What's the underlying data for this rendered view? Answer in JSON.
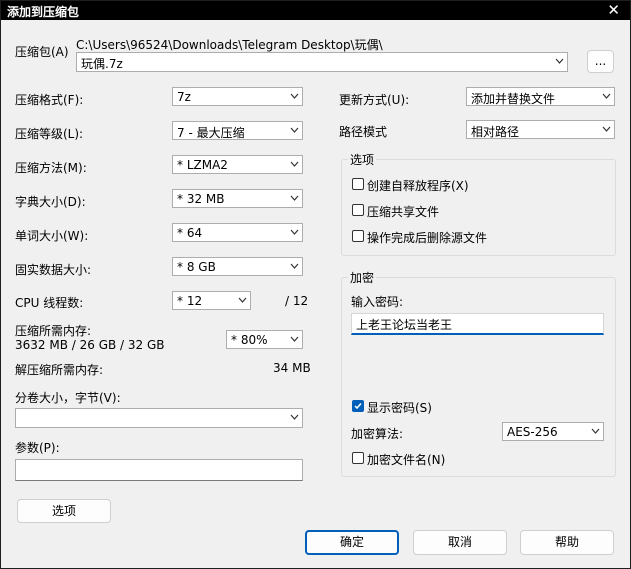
{
  "window": {
    "title": "添加到压缩包",
    "close_glyph": "✕"
  },
  "archive": {
    "label": "压缩包(A)",
    "path": "C:\\Users\\96524\\Downloads\\Telegram Desktop\\玩偶\\",
    "value": "玩偶.7z",
    "browse_label": "..."
  },
  "left": {
    "format": {
      "label": "压缩格式(F):",
      "value": "7z"
    },
    "level": {
      "label": "压缩等级(L):",
      "value": "7 - 最大压缩"
    },
    "method": {
      "label": "压缩方法(M):",
      "value": "* LZMA2"
    },
    "dict": {
      "label": "字典大小(D):",
      "value": "* 32 MB"
    },
    "word": {
      "label": "单词大小(W):",
      "value": "* 64"
    },
    "solid": {
      "label": "固实数据大小:",
      "value": "* 8 GB"
    },
    "threads": {
      "label": "CPU 线程数:",
      "value": "* 12",
      "max": "/ 12"
    },
    "mem": {
      "label": "压缩所需内存:",
      "detail": "3632 MB / 26 GB / 32 GB",
      "value": "* 80%"
    },
    "decomp": {
      "label": "解压缩所需内存:",
      "value": "34 MB"
    },
    "volume": {
      "label": "分卷大小，字节(V):",
      "value": ""
    },
    "params": {
      "label": "参数(P):",
      "value": ""
    },
    "options_button": "选项"
  },
  "right": {
    "update": {
      "label": "更新方式(U):",
      "value": "添加并替换文件"
    },
    "pathmode": {
      "label": "路径模式",
      "value": "相对路径"
    },
    "options_group": {
      "title": "选项",
      "items": [
        {
          "label": "创建自释放程序(X)",
          "checked": false
        },
        {
          "label": "压缩共享文件",
          "checked": false
        },
        {
          "label": "操作完成后删除源文件",
          "checked": false
        }
      ]
    },
    "encryption": {
      "title": "加密",
      "password_label": "输入密码:",
      "password_value": "上老王论坛当老王",
      "show_password": {
        "label": "显示密码(S)",
        "checked": true
      },
      "algo_label": "加密算法:",
      "algo_value": "AES-256",
      "encrypt_names": {
        "label": "加密文件名(N)",
        "checked": false
      }
    }
  },
  "buttons": {
    "ok": "确定",
    "cancel": "取消",
    "help": "帮助"
  }
}
